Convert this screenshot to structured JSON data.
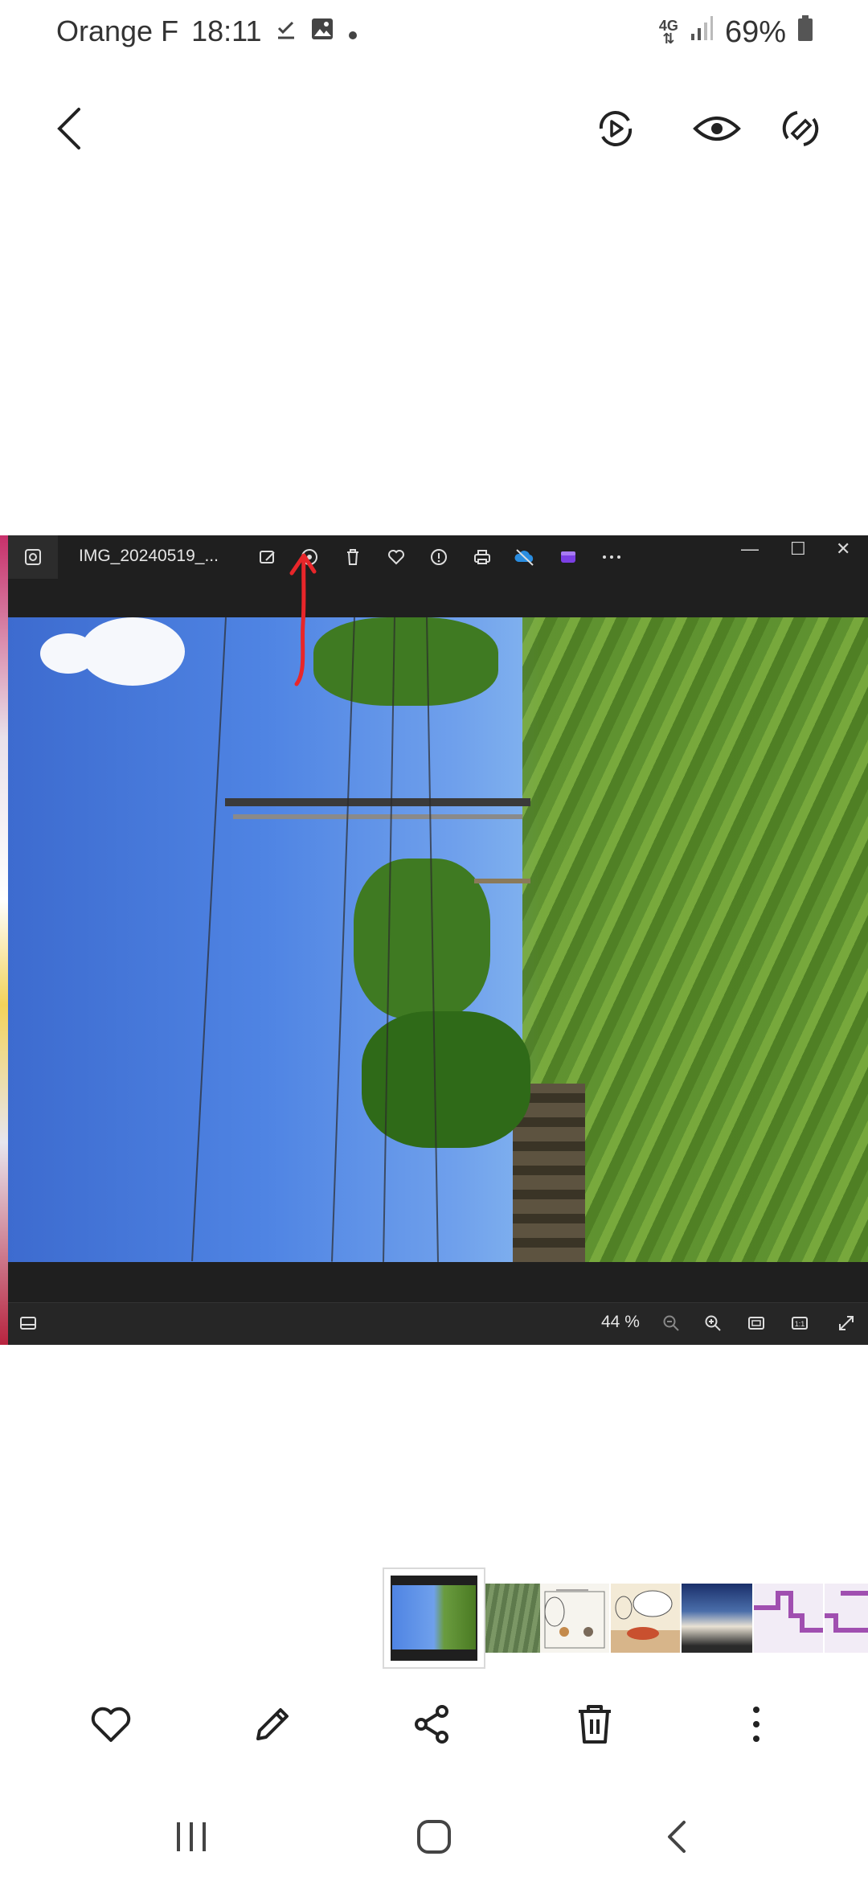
{
  "status_bar": {
    "carrier": "Orange F",
    "time": "18:11",
    "network": "4G",
    "battery": "69%",
    "icons": [
      "download-done-icon",
      "gallery-icon",
      "dot-icon",
      "signal-icon",
      "battery-icon"
    ]
  },
  "app_bar": {
    "back_icon": "back-arrow-icon",
    "actions": [
      "motion-photo-play-icon",
      "view-icon",
      "rotate-icon"
    ]
  },
  "embedded_screenshot": {
    "window_title": "IMG_20240519_...",
    "zoom_level": "44 %",
    "toolbar_icons": [
      "edit-image-icon",
      "rotate-view-icon",
      "delete-icon",
      "favorite-icon",
      "info-icon",
      "print-icon",
      "cloud-icon",
      "clipchamp-icon",
      "more-icon"
    ],
    "window_controls": [
      "minimize",
      "maximize",
      "close"
    ],
    "window_control_glyphs": {
      "minimize": "—",
      "maximize": "☐",
      "close": "✕"
    },
    "annotation_color": "#e8262a"
  },
  "filmstrip": {
    "thumbnails": [
      "photo-selected",
      "grass-photo",
      "comic-strip",
      "comic-strip-2",
      "cloud-photo",
      "pixel-drawing",
      "pixel-drawing-2"
    ]
  },
  "bottom_actions": [
    "favorite-icon",
    "edit-icon",
    "share-icon",
    "delete-icon",
    "more-options-icon"
  ],
  "nav_bar": [
    "recents-icon",
    "home-icon",
    "back-icon"
  ],
  "colors": {
    "accent_red": "#e8262a",
    "dark_chrome": "#1f1f1f",
    "background": "#ffffff"
  }
}
